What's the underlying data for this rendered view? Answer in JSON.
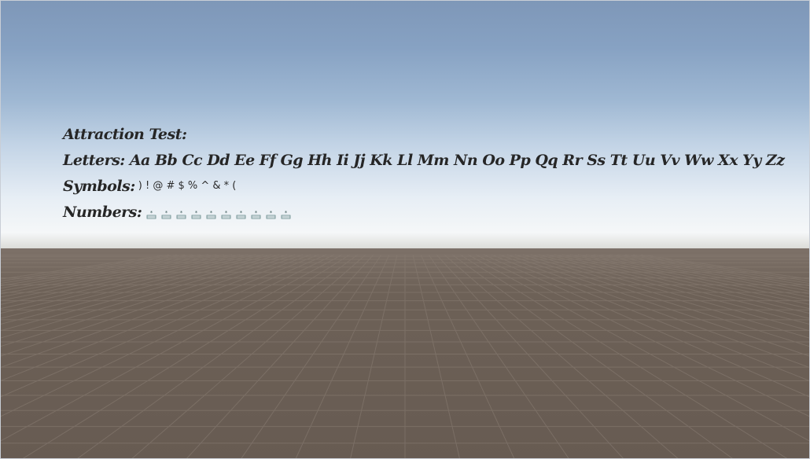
{
  "scene": {
    "sky_top_color": "#7e97b8",
    "horizon_color": "#f5f7f8",
    "ground_color": "#6b5f56"
  },
  "text": {
    "title": "Attraction Test:",
    "letters_label": "Letters:",
    "letters_value": "Aa Bb Cc Dd Ee Ff Gg Hh Ii Jj Kk Ll Mm Nn Oo Pp Qq Rr Ss Tt Uu Vv Ww Xx Yy Zz",
    "symbols_label": "Symbols:",
    "symbols_value": ") ! @ # $ % ^ & * (",
    "numbers_label": "Numbers:",
    "numbers_glyph_count": 10,
    "numbers_glyph_icon": "missing-glyph-icon"
  }
}
